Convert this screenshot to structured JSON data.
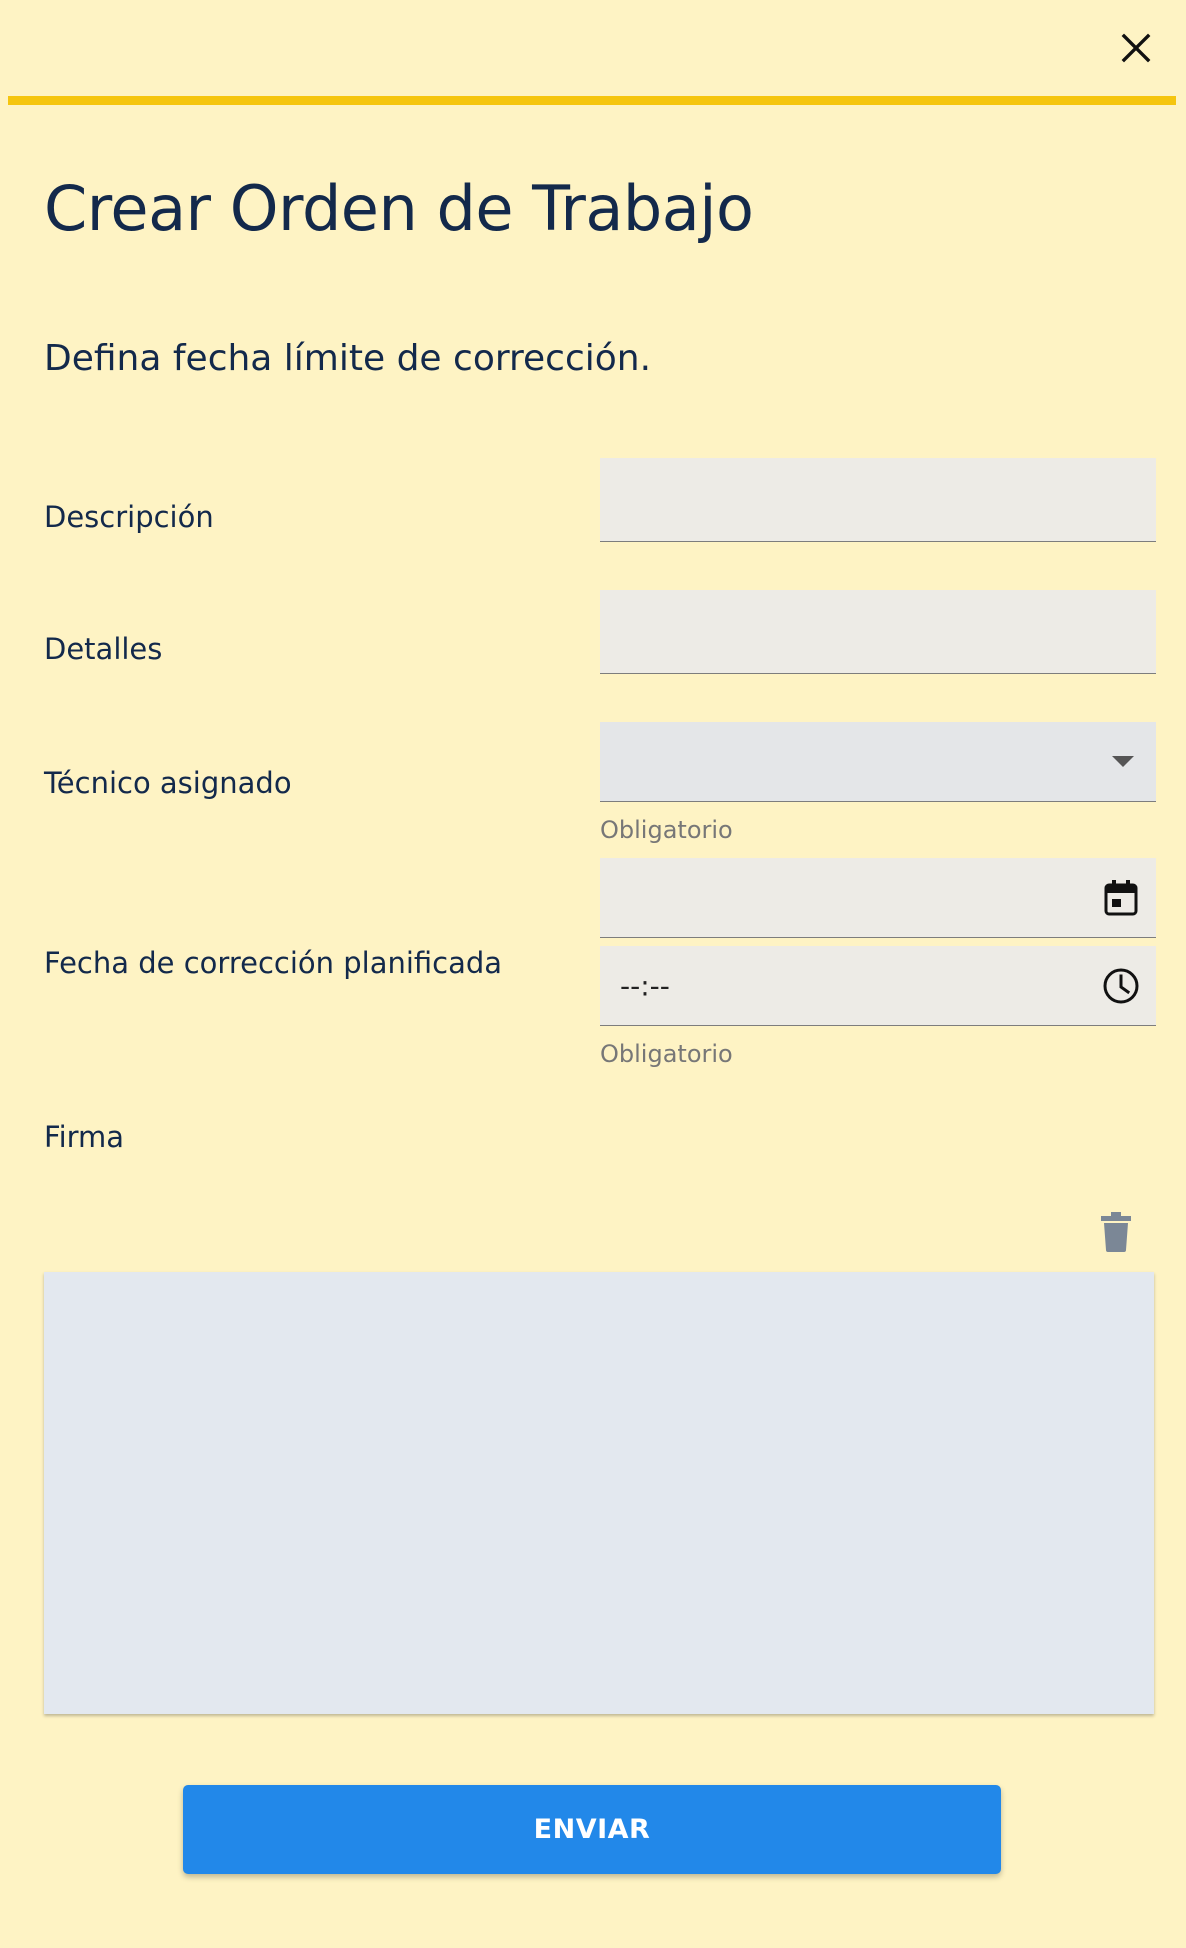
{
  "dialog": {
    "title": "Crear Orden de Trabajo",
    "subtitle": "Defina fecha límite de corrección.",
    "close_icon": "close-icon"
  },
  "form": {
    "descripcion": {
      "label": "Descripción",
      "value": ""
    },
    "detalles": {
      "label": "Detalles",
      "value": ""
    },
    "tecnico": {
      "label": "Técnico asignado",
      "value": "",
      "helper": "Obligatorio",
      "icon": "dropdown-arrow-icon"
    },
    "fecha": {
      "label": "Fecha de corrección planificada",
      "date_value": "",
      "time_value": "--:--",
      "helper": "Obligatorio",
      "date_icon": "calendar-icon",
      "time_icon": "clock-icon"
    },
    "firma": {
      "label": "Firma",
      "clear_icon": "trash-icon"
    }
  },
  "submit": {
    "label": "ENVIAR"
  },
  "colors": {
    "background": "#fef3c4",
    "accent_bar": "#f5c50f",
    "primary_button": "#2288e9",
    "text": "#13294b"
  }
}
